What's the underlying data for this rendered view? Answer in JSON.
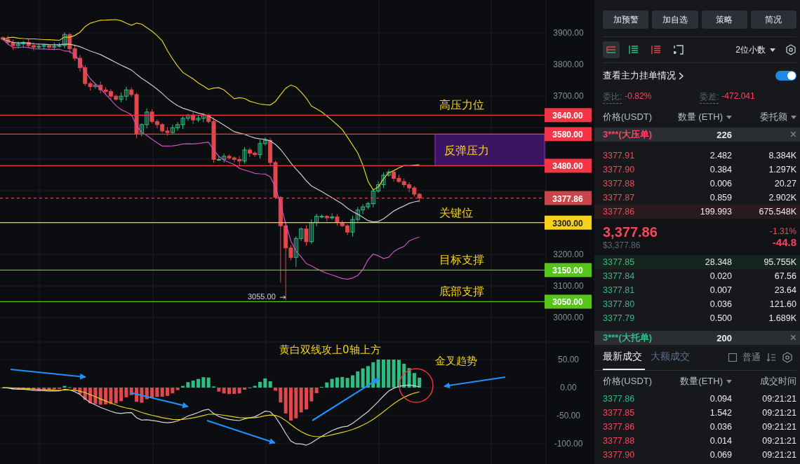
{
  "chart": {
    "y_axis": [
      "3900.00",
      "3800.00",
      "3700.00",
      "3200.00",
      "3100.00",
      "3000.00"
    ],
    "levels": [
      {
        "price": "3640.00",
        "kind": "line",
        "color": "#f23645",
        "label": "高压力位"
      },
      {
        "price": "3580.00",
        "kind": "zone-top",
        "color": "#f23645"
      },
      {
        "price": "3480.00",
        "kind": "zone-bottom",
        "color": "#f23645"
      },
      {
        "price": "3377.86",
        "kind": "dashed",
        "color": "#c8454a"
      },
      {
        "price": "3300.00",
        "kind": "line",
        "color": "#f5d21c",
        "label": "关键位"
      },
      {
        "price": "3150.00",
        "kind": "line",
        "color": "#56c41a",
        "label": "目标支撑"
      },
      {
        "price": "3050.00",
        "kind": "line",
        "color": "#56c41a",
        "label": "底部支撑"
      }
    ],
    "zone": {
      "label": "反弹压力"
    },
    "low_marker": "3055.00"
  },
  "macd": {
    "y_axis": [
      "50.00",
      "0.00",
      "-50.00",
      "-100.00"
    ],
    "annotations": [
      "黄白双线攻上0轴上方",
      "金叉趋势"
    ]
  },
  "panel": {
    "buttons": [
      "加预警",
      "加自选",
      "策略",
      "简况"
    ],
    "view_icons": [
      {
        "kind": "both",
        "selected": true
      },
      {
        "kind": "bids",
        "selected": false
      },
      {
        "kind": "asks",
        "selected": false
      },
      {
        "kind": "grid",
        "selected": false
      }
    ],
    "decimals": "2位小数",
    "main_orders": {
      "label": "查看主力挂单情况",
      "on": true
    },
    "ratio": {
      "label": "委比:",
      "value": "-0.82%"
    },
    "diff": {
      "label": "委差:",
      "value": "-472.041"
    },
    "columns": [
      {
        "label": "价格(USDT)",
        "dropdown": false
      },
      {
        "label": "数量 (ETH)",
        "dropdown": true
      },
      {
        "label": "委托额",
        "dropdown": true
      }
    ],
    "big_ask": {
      "label": "3***(大压单)",
      "qty": "226",
      "close": "×"
    },
    "asks": [
      {
        "price": "3377.91",
        "qty": "2.482",
        "amount": "8.384K",
        "highlighted": false
      },
      {
        "price": "3377.90",
        "qty": "0.384",
        "amount": "1.297K",
        "highlighted": false
      },
      {
        "price": "3377.88",
        "qty": "0.006",
        "amount": "20.27",
        "highlighted": false
      },
      {
        "price": "3377.87",
        "qty": "0.859",
        "amount": "2.902K",
        "highlighted": false
      },
      {
        "price": "3377.86",
        "qty": "199.993",
        "amount": "675.548K",
        "highlighted": true
      }
    ],
    "last": {
      "price": "3,377.86",
      "usd": "$3,377.86",
      "change_pct": "-1.31%",
      "change": "-44.8"
    },
    "bids": [
      {
        "price": "3377.85",
        "qty": "28.348",
        "amount": "95.755K",
        "highlighted": true
      },
      {
        "price": "3377.84",
        "qty": "0.020",
        "amount": "67.56",
        "highlighted": false
      },
      {
        "price": "3377.81",
        "qty": "0.007",
        "amount": "23.64",
        "highlighted": false
      },
      {
        "price": "3377.80",
        "qty": "0.036",
        "amount": "121.60",
        "highlighted": false
      },
      {
        "price": "3377.79",
        "qty": "0.500",
        "amount": "1.689K",
        "highlighted": false
      }
    ],
    "big_bid": {
      "label": "3***(大托单)",
      "qty": "200",
      "close": "×"
    },
    "trade_tabs": [
      {
        "label": "最新成交",
        "selected": true
      },
      {
        "label": "大额成交",
        "selected": false
      }
    ],
    "normal_filter": {
      "label": "普通",
      "checked": false
    },
    "trade_columns": [
      {
        "label": "价格(USDT)",
        "dropdown": false
      },
      {
        "label": "数量(ETH)",
        "dropdown": true
      },
      {
        "label": "成交时间",
        "dropdown": false
      }
    ],
    "trades": [
      {
        "price": "3377.86",
        "qty": "0.094",
        "time": "09:21:21",
        "kind": "buy"
      },
      {
        "price": "3377.85",
        "qty": "1.542",
        "time": "09:21:21",
        "kind": "sell"
      },
      {
        "price": "3377.86",
        "qty": "0.036",
        "time": "09:21:21",
        "kind": "sell"
      },
      {
        "price": "3377.88",
        "qty": "0.014",
        "time": "09:21:21",
        "kind": "sell"
      },
      {
        "price": "3377.90",
        "qty": "0.069",
        "time": "09:21:21",
        "kind": "sell"
      }
    ]
  }
}
